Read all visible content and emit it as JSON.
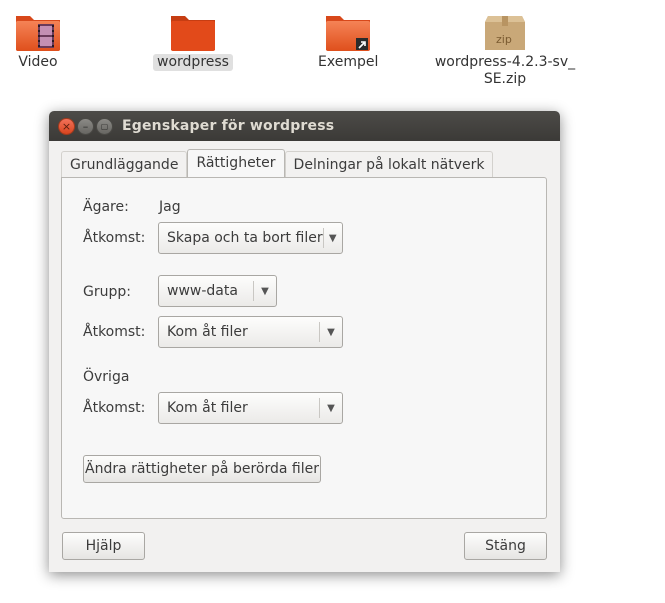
{
  "desktop": {
    "icons": [
      {
        "label": "Video",
        "name": "folder-video-icon"
      },
      {
        "label": "wordpress",
        "name": "folder-icon"
      },
      {
        "label": "Exempel",
        "name": "folder-link-icon"
      },
      {
        "label_line1": "wordpress-4.2.3-sv_",
        "label_line2": "SE.zip",
        "badge": "zip",
        "name": "zip-archive-icon"
      }
    ]
  },
  "dialog": {
    "title": "Egenskaper för wordpress",
    "tabs": [
      "Grundläggande",
      "Rättigheter",
      "Delningar på lokalt nätverk"
    ],
    "active_tab": "Rättigheter",
    "owner": {
      "label": "Ägare:",
      "value": "Jag"
    },
    "owner_access": {
      "label": "Åtkomst:",
      "value": "Skapa och ta bort filer"
    },
    "group": {
      "label": "Grupp:",
      "value": "www-data"
    },
    "group_access": {
      "label": "Åtkomst:",
      "value": "Kom åt filer"
    },
    "others": {
      "label": "Övriga"
    },
    "others_access": {
      "label": "Åtkomst:",
      "value": "Kom åt filer"
    },
    "change_button": "Ändra rättigheter på berörda filer",
    "help_button": "Hjälp",
    "close_button": "Stäng"
  },
  "colors": {
    "folder_orange": "#e95420",
    "titlebar": "#3c3b37",
    "close_btn": "#e25a34"
  }
}
